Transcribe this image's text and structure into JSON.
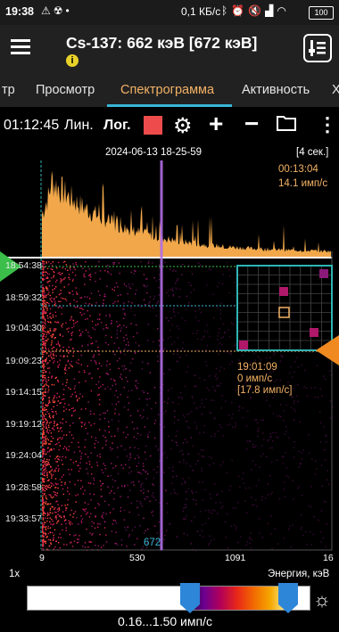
{
  "status_bar": {
    "time": "19:38",
    "speed": "0,1 КБ/с",
    "battery": "100",
    "icons": [
      "warning-icon",
      "radiation-icon",
      "dot-icon",
      "bluetooth-icon",
      "alarm-icon",
      "mute-icon",
      "signal-icon",
      "wifi-icon"
    ]
  },
  "appbar": {
    "title": "Cs-137: 662 кэВ [672 кэВ]"
  },
  "tabs": [
    {
      "label": "тр",
      "active": false
    },
    {
      "label": "Просмотр",
      "active": false
    },
    {
      "label": "Спектрограмма",
      "active": true
    },
    {
      "label": "Активность",
      "active": false
    },
    {
      "label": "Х",
      "active": false
    }
  ],
  "toolbar": {
    "elapsed": "01:12:45",
    "lin_label": "Лин.",
    "log_label": "Лог."
  },
  "chart_header": {
    "datetime": "2024-06-13 18-25-59",
    "interval": "[4 сек.]",
    "cursor_time": "00:13:04",
    "cursor_rate": "14.1 имп/с"
  },
  "spectrogram": {
    "y_times": [
      "18:54:38",
      "18:59:32",
      "19:04:30",
      "19:09:23",
      "19:14:15",
      "19:19:12",
      "19:24:04",
      "19:28:58",
      "19:33:57"
    ],
    "marker_value": "672",
    "x_ticks": [
      "9",
      "530",
      "1091",
      "16"
    ],
    "zoom": "1x",
    "x_label": "Энергия, кэВ",
    "inset": {
      "time": "19:01:09",
      "rate": "0 имп/с",
      "avg": "[17.8 имп/с]"
    }
  },
  "legend": {
    "range": "0.16...1.50 имп/с"
  },
  "colors": {
    "accent_orange": "#f4b266",
    "accent_teal": "#38b6d6",
    "marker_purple": "#b26ee6",
    "record_red": "#ee4c4c",
    "green_arrow": "#3bbf4a"
  }
}
